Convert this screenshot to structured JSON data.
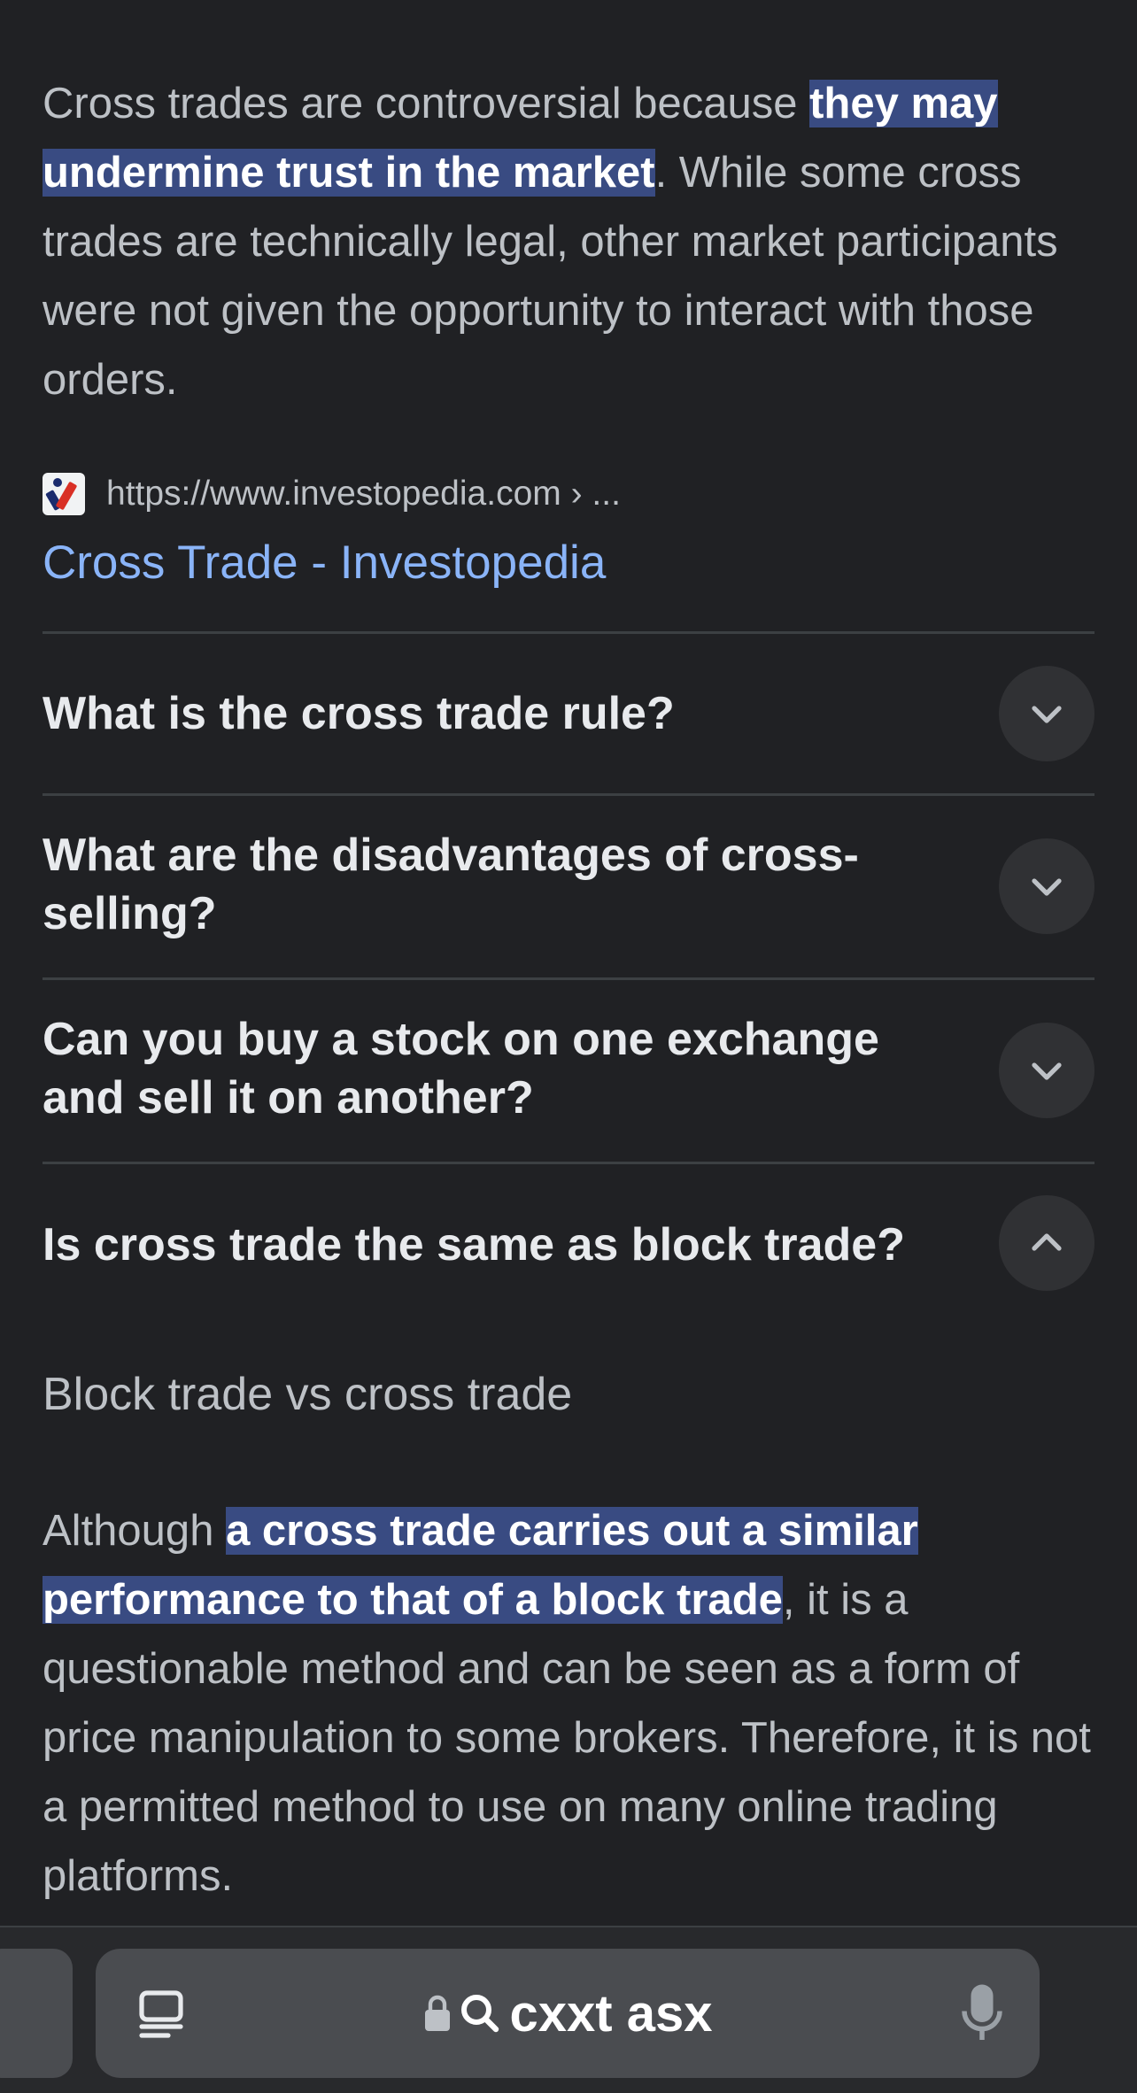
{
  "snippet": {
    "text_before": "Cross trades are controversial because ",
    "highlight": "they may undermine trust in the market",
    "text_after": ". While some cross trades are technically legal, other market participants were not given the opportunity to interact with those orders."
  },
  "source": {
    "favicon": "investopedia-favicon",
    "url": "https://www.investopedia.com › ...",
    "title": "Cross Trade - Investopedia"
  },
  "faq": [
    {
      "question": "What is the cross trade rule?",
      "icon": "chevron-down-icon"
    },
    {
      "question": "What are the disadvantages of cross-selling?",
      "icon": "chevron-down-icon"
    },
    {
      "question": "Can you buy a stock on one exchange and sell it on another?",
      "icon": "chevron-down-icon"
    },
    {
      "question": "Is cross trade the same as block trade?",
      "icon": "chevron-up-icon"
    }
  ],
  "answer": {
    "title": "Block trade vs cross trade",
    "text_before": "Although ",
    "highlight": "a cross trade carries out a similar performance to that of a block trade",
    "text_after": ", it is a questionable method and can be seen as a form of price manipulation to some brokers. Therefore, it is not a permitted method to use on many online trading platforms."
  },
  "bottom_bar": {
    "address_text": "cxxt asx",
    "icons": [
      "tabs-icon",
      "lock-icon",
      "search-icon",
      "mic-icon"
    ]
  },
  "colors": {
    "background": "#202124",
    "highlight": "#394b82",
    "link": "#8ab4f8"
  }
}
